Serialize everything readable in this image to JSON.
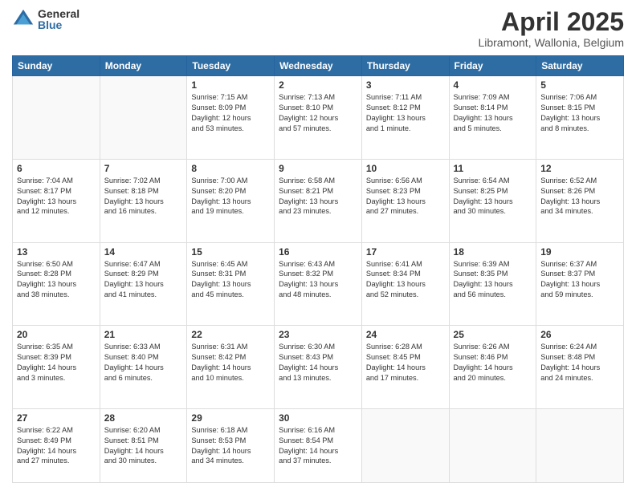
{
  "header": {
    "logo_general": "General",
    "logo_blue": "Blue",
    "month_title": "April 2025",
    "location": "Libramont, Wallonia, Belgium"
  },
  "days_of_week": [
    "Sunday",
    "Monday",
    "Tuesday",
    "Wednesday",
    "Thursday",
    "Friday",
    "Saturday"
  ],
  "weeks": [
    [
      {
        "day": "",
        "content": ""
      },
      {
        "day": "",
        "content": ""
      },
      {
        "day": "1",
        "content": "Sunrise: 7:15 AM\nSunset: 8:09 PM\nDaylight: 12 hours\nand 53 minutes."
      },
      {
        "day": "2",
        "content": "Sunrise: 7:13 AM\nSunset: 8:10 PM\nDaylight: 12 hours\nand 57 minutes."
      },
      {
        "day": "3",
        "content": "Sunrise: 7:11 AM\nSunset: 8:12 PM\nDaylight: 13 hours\nand 1 minute."
      },
      {
        "day": "4",
        "content": "Sunrise: 7:09 AM\nSunset: 8:14 PM\nDaylight: 13 hours\nand 5 minutes."
      },
      {
        "day": "5",
        "content": "Sunrise: 7:06 AM\nSunset: 8:15 PM\nDaylight: 13 hours\nand 8 minutes."
      }
    ],
    [
      {
        "day": "6",
        "content": "Sunrise: 7:04 AM\nSunset: 8:17 PM\nDaylight: 13 hours\nand 12 minutes."
      },
      {
        "day": "7",
        "content": "Sunrise: 7:02 AM\nSunset: 8:18 PM\nDaylight: 13 hours\nand 16 minutes."
      },
      {
        "day": "8",
        "content": "Sunrise: 7:00 AM\nSunset: 8:20 PM\nDaylight: 13 hours\nand 19 minutes."
      },
      {
        "day": "9",
        "content": "Sunrise: 6:58 AM\nSunset: 8:21 PM\nDaylight: 13 hours\nand 23 minutes."
      },
      {
        "day": "10",
        "content": "Sunrise: 6:56 AM\nSunset: 8:23 PM\nDaylight: 13 hours\nand 27 minutes."
      },
      {
        "day": "11",
        "content": "Sunrise: 6:54 AM\nSunset: 8:25 PM\nDaylight: 13 hours\nand 30 minutes."
      },
      {
        "day": "12",
        "content": "Sunrise: 6:52 AM\nSunset: 8:26 PM\nDaylight: 13 hours\nand 34 minutes."
      }
    ],
    [
      {
        "day": "13",
        "content": "Sunrise: 6:50 AM\nSunset: 8:28 PM\nDaylight: 13 hours\nand 38 minutes."
      },
      {
        "day": "14",
        "content": "Sunrise: 6:47 AM\nSunset: 8:29 PM\nDaylight: 13 hours\nand 41 minutes."
      },
      {
        "day": "15",
        "content": "Sunrise: 6:45 AM\nSunset: 8:31 PM\nDaylight: 13 hours\nand 45 minutes."
      },
      {
        "day": "16",
        "content": "Sunrise: 6:43 AM\nSunset: 8:32 PM\nDaylight: 13 hours\nand 48 minutes."
      },
      {
        "day": "17",
        "content": "Sunrise: 6:41 AM\nSunset: 8:34 PM\nDaylight: 13 hours\nand 52 minutes."
      },
      {
        "day": "18",
        "content": "Sunrise: 6:39 AM\nSunset: 8:35 PM\nDaylight: 13 hours\nand 56 minutes."
      },
      {
        "day": "19",
        "content": "Sunrise: 6:37 AM\nSunset: 8:37 PM\nDaylight: 13 hours\nand 59 minutes."
      }
    ],
    [
      {
        "day": "20",
        "content": "Sunrise: 6:35 AM\nSunset: 8:39 PM\nDaylight: 14 hours\nand 3 minutes."
      },
      {
        "day": "21",
        "content": "Sunrise: 6:33 AM\nSunset: 8:40 PM\nDaylight: 14 hours\nand 6 minutes."
      },
      {
        "day": "22",
        "content": "Sunrise: 6:31 AM\nSunset: 8:42 PM\nDaylight: 14 hours\nand 10 minutes."
      },
      {
        "day": "23",
        "content": "Sunrise: 6:30 AM\nSunset: 8:43 PM\nDaylight: 14 hours\nand 13 minutes."
      },
      {
        "day": "24",
        "content": "Sunrise: 6:28 AM\nSunset: 8:45 PM\nDaylight: 14 hours\nand 17 minutes."
      },
      {
        "day": "25",
        "content": "Sunrise: 6:26 AM\nSunset: 8:46 PM\nDaylight: 14 hours\nand 20 minutes."
      },
      {
        "day": "26",
        "content": "Sunrise: 6:24 AM\nSunset: 8:48 PM\nDaylight: 14 hours\nand 24 minutes."
      }
    ],
    [
      {
        "day": "27",
        "content": "Sunrise: 6:22 AM\nSunset: 8:49 PM\nDaylight: 14 hours\nand 27 minutes."
      },
      {
        "day": "28",
        "content": "Sunrise: 6:20 AM\nSunset: 8:51 PM\nDaylight: 14 hours\nand 30 minutes."
      },
      {
        "day": "29",
        "content": "Sunrise: 6:18 AM\nSunset: 8:53 PM\nDaylight: 14 hours\nand 34 minutes."
      },
      {
        "day": "30",
        "content": "Sunrise: 6:16 AM\nSunset: 8:54 PM\nDaylight: 14 hours\nand 37 minutes."
      },
      {
        "day": "",
        "content": ""
      },
      {
        "day": "",
        "content": ""
      },
      {
        "day": "",
        "content": ""
      }
    ]
  ]
}
